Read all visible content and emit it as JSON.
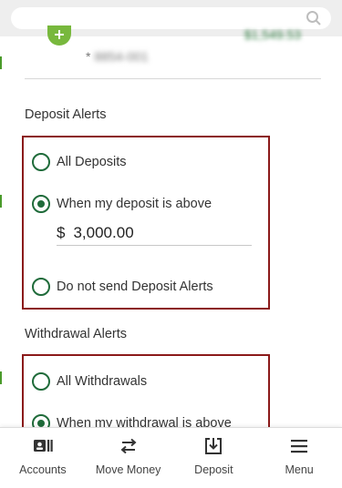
{
  "search": {
    "placeholder": ""
  },
  "account": {
    "balance": "$1,549.53",
    "number_prefix": "*",
    "number_masked": "8854-001"
  },
  "deposit_alerts": {
    "title": "Deposit Alerts",
    "options": [
      {
        "label": "All Deposits",
        "checked": false
      },
      {
        "label": "When my deposit is above",
        "checked": true
      },
      {
        "label": "Do not send Deposit Alerts",
        "checked": false
      }
    ],
    "amount": {
      "currency": "$",
      "value": "3,000.00"
    }
  },
  "withdrawal_alerts": {
    "title": "Withdrawal Alerts",
    "options": [
      {
        "label": "All Withdrawals",
        "checked": false
      },
      {
        "label": "When my withdrawal is above",
        "checked": true
      }
    ]
  },
  "bottom_nav": [
    {
      "label": "Accounts",
      "icon": "accounts-icon"
    },
    {
      "label": "Move Money",
      "icon": "transfer-arrows-icon"
    },
    {
      "label": "Deposit",
      "icon": "deposit-icon"
    },
    {
      "label": "Menu",
      "icon": "menu-icon"
    }
  ],
  "colors": {
    "accent_green": "#1f6b3a",
    "highlight_red": "#8b1a1a",
    "badge_green": "#78b83d"
  }
}
